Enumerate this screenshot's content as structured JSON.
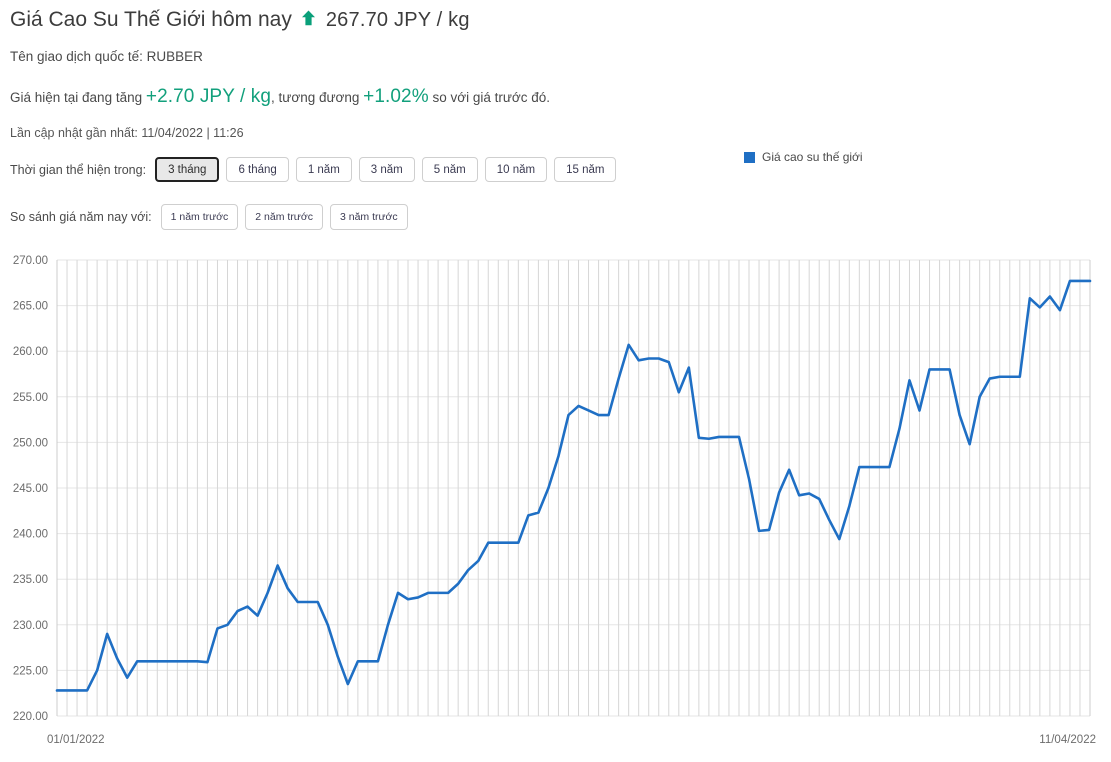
{
  "header": {
    "title": "Giá Cao Su Thế Giới hôm nay",
    "arrow_icon": "arrow-up-icon",
    "price_value": "267.70 JPY / kg",
    "symbol_line": "Tên giao dịch quốc tế: RUBBER",
    "change_prefix": "Giá hiện tại đang tăng",
    "change_amount": "+2.70 JPY / kg",
    "change_mid": ", tương đương",
    "change_percent": "+1.02%",
    "change_suffix": "so với giá trước đó.",
    "updated": "Lần cập nhật gần nhất: 11/04/2022 | 11:26"
  },
  "controls": {
    "range_label": "Thời gian thể hiện trong:",
    "ranges": [
      {
        "label": "3 tháng",
        "active": true
      },
      {
        "label": "6 tháng",
        "active": false
      },
      {
        "label": "1 năm",
        "active": false
      },
      {
        "label": "3 năm",
        "active": false
      },
      {
        "label": "5 năm",
        "active": false
      },
      {
        "label": "10 năm",
        "active": false
      },
      {
        "label": "15 năm",
        "active": false
      }
    ],
    "compare_label": "So sánh giá năm nay với:",
    "compares": [
      {
        "label": "1 năm trước"
      },
      {
        "label": "2 năm trước"
      },
      {
        "label": "3 năm trước"
      }
    ]
  },
  "legend": {
    "series_label": "Giá cao su thế giới",
    "color": "#1f6fc4"
  },
  "colors": {
    "line": "#1f6fc4",
    "accent_green": "#12a07c",
    "grid": "#d6d6d6",
    "grid_h": "#e6e6e6",
    "text": "#4a4a4a"
  },
  "chart_data": {
    "type": "line",
    "title": "Giá cao su thế giới",
    "xlabel": "",
    "ylabel": "",
    "ylim": [
      220,
      270
    ],
    "ytick_step": 5,
    "ytick_labels": [
      "220.00",
      "225.00",
      "230.00",
      "235.00",
      "240.00",
      "245.00",
      "250.00",
      "255.00",
      "260.00",
      "265.00",
      "270.00"
    ],
    "xtick_labels": [
      "01/01/2022",
      "11/04/2022"
    ],
    "x_start": "01/01/2022",
    "x_end": "11/04/2022",
    "grid": true,
    "legend_position": "top-right",
    "series": [
      {
        "name": "Giá cao su thế giới",
        "color": "#1f6fc4",
        "unit": "JPY / kg",
        "values": [
          222.8,
          222.8,
          222.8,
          222.8,
          225.0,
          229.0,
          226.3,
          224.2,
          226.0,
          226.0,
          226.0,
          226.0,
          226.0,
          226.0,
          226.0,
          225.9,
          229.6,
          230.0,
          231.5,
          232.0,
          231.0,
          233.5,
          236.5,
          234.0,
          232.5,
          232.5,
          232.5,
          230.0,
          226.5,
          223.5,
          226.0,
          226.0,
          226.0,
          230.0,
          233.5,
          232.8,
          233.0,
          233.5,
          233.5,
          233.5,
          234.5,
          236.0,
          237.0,
          239.0,
          239.0,
          239.0,
          239.0,
          242.0,
          242.3,
          245.0,
          248.5,
          253.0,
          254.0,
          253.5,
          253.0,
          253.0,
          257.0,
          260.7,
          259.0,
          259.2,
          259.2,
          258.8,
          255.5,
          258.2,
          250.5,
          250.4,
          250.6,
          250.6,
          250.6,
          246.0,
          240.3,
          240.4,
          244.5,
          247.0,
          244.2,
          244.4,
          243.8,
          241.5,
          239.4,
          243.0,
          247.3,
          247.3,
          247.3,
          247.3,
          251.5,
          256.8,
          253.5,
          258.0,
          258.0,
          258.0,
          253.0,
          249.8,
          255.0,
          257.0,
          257.2,
          257.2,
          257.2,
          265.8,
          264.8,
          266.0,
          264.5,
          267.7,
          267.7,
          267.7
        ]
      }
    ]
  }
}
